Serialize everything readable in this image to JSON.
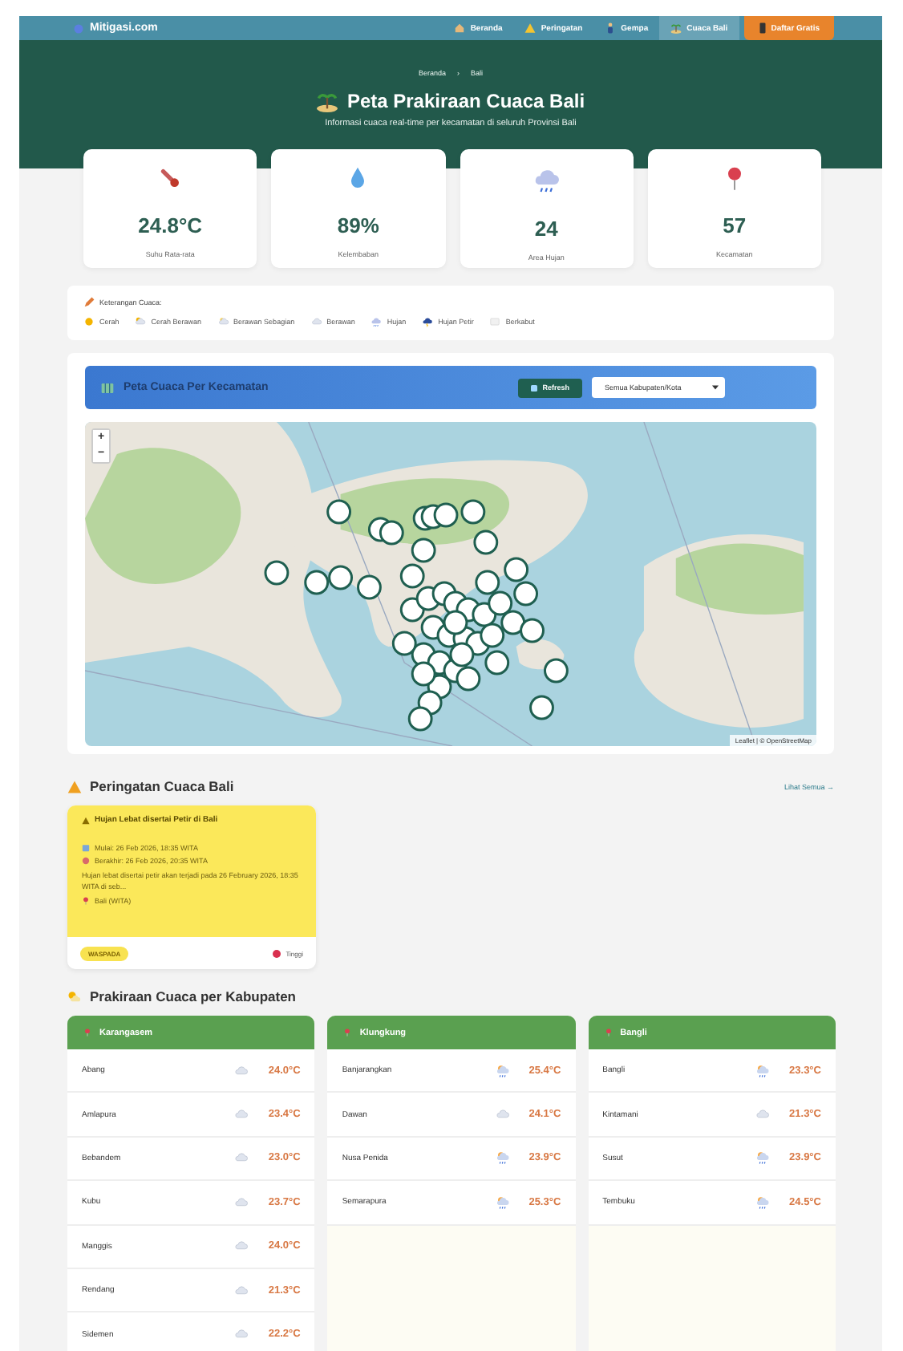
{
  "nav": {
    "logo": "Mitigasi.com",
    "items": [
      {
        "label": "Beranda",
        "kind": "home",
        "selected": false
      },
      {
        "label": "Peringatan",
        "kind": "warning",
        "selected": false
      },
      {
        "label": "Gempa",
        "kind": "pulse",
        "selected": false
      },
      {
        "label": "Cuaca Bali",
        "kind": "island",
        "selected": true
      }
    ],
    "cta": "Daftar Gratis"
  },
  "hero": {
    "breadcrumb": [
      "Beranda",
      "Bali"
    ],
    "separator": "›",
    "title": "Peta Prakiraan Cuaca Bali",
    "subtitle": "Informasi cuaca real-time per kecamatan di seluruh Provinsi Bali"
  },
  "stats": [
    {
      "kind": "temperature",
      "value": "24.8°C",
      "label": "Suhu Rata-rata"
    },
    {
      "kind": "humidity",
      "value": "89%",
      "label": "Kelembaban"
    },
    {
      "kind": "rain",
      "value": "24",
      "label": "Area Hujan"
    },
    {
      "kind": "location",
      "value": "57",
      "label": "Kecamatan"
    }
  ],
  "legend": {
    "title": "Keterangan Cuaca:",
    "items": [
      {
        "kind": "sunny",
        "label": "Cerah"
      },
      {
        "kind": "sun-cloud",
        "label": "Cerah Berawan"
      },
      {
        "kind": "partly-cloudy",
        "label": "Berawan Sebagian"
      },
      {
        "kind": "cloudy",
        "label": "Berawan"
      },
      {
        "kind": "rain",
        "label": "Hujan"
      },
      {
        "kind": "storm",
        "label": "Hujan Petir"
      },
      {
        "kind": "fog",
        "label": "Berkabut"
      }
    ]
  },
  "map_panel": {
    "title": "Peta Cuaca Per Kecamatan",
    "refresh": "Refresh",
    "filter": "Semua Kabupaten/Kota",
    "zoom_in": "+",
    "zoom_out": "−",
    "attribution": "Leaflet | © OpenStreetMap"
  },
  "alerts": {
    "title": "Peringatan Cuaca Bali",
    "link": "Lihat Semua →",
    "items": [
      {
        "title": "Hujan Lebat disertai Petir di Bali",
        "start": "Mulai: 26 Feb 2026, 18:35 WITA",
        "end": "Berakhir: 26 Feb 2026, 20:35 WITA",
        "description": "Hujan lebat disertai petir akan terjadi pada 26 February 2026, 18:35 WITA di seb...",
        "area": "Bali (WITA)",
        "badge": "WASPADA",
        "severity": "Tinggi"
      }
    ]
  },
  "forecast": {
    "title": "Prakiraan Cuaca per Kabupaten",
    "regencies": [
      {
        "name": "Karangasem",
        "districts": [
          {
            "name": "Abang",
            "kind": "cloudy",
            "temp": "24.0°C"
          },
          {
            "name": "Amlapura",
            "kind": "cloudy",
            "temp": "23.4°C"
          },
          {
            "name": "Bebandem",
            "kind": "cloudy",
            "temp": "23.0°C"
          },
          {
            "name": "Kubu",
            "kind": "cloudy",
            "temp": "23.7°C"
          },
          {
            "name": "Manggis",
            "kind": "cloudy",
            "temp": "24.0°C"
          },
          {
            "name": "Rendang",
            "kind": "cloudy",
            "temp": "21.3°C"
          },
          {
            "name": "Sidemen",
            "kind": "cloudy",
            "temp": "22.2°C"
          }
        ]
      },
      {
        "name": "Klungkung",
        "districts": [
          {
            "name": "Banjarangkan",
            "kind": "sun-rain",
            "temp": "25.4°C"
          },
          {
            "name": "Dawan",
            "kind": "cloudy",
            "temp": "24.1°C"
          },
          {
            "name": "Nusa Penida",
            "kind": "sun-rain",
            "temp": "23.9°C"
          },
          {
            "name": "Semarapura",
            "kind": "sun-rain",
            "temp": "25.3°C"
          }
        ]
      },
      {
        "name": "Bangli",
        "districts": [
          {
            "name": "Bangli",
            "kind": "sun-rain",
            "temp": "23.3°C"
          },
          {
            "name": "Kintamani",
            "kind": "cloudy",
            "temp": "21.3°C"
          },
          {
            "name": "Susut",
            "kind": "sun-rain",
            "temp": "23.9°C"
          },
          {
            "name": "Tembuku",
            "kind": "sun-rain",
            "temp": "24.5°C"
          }
        ]
      }
    ]
  }
}
